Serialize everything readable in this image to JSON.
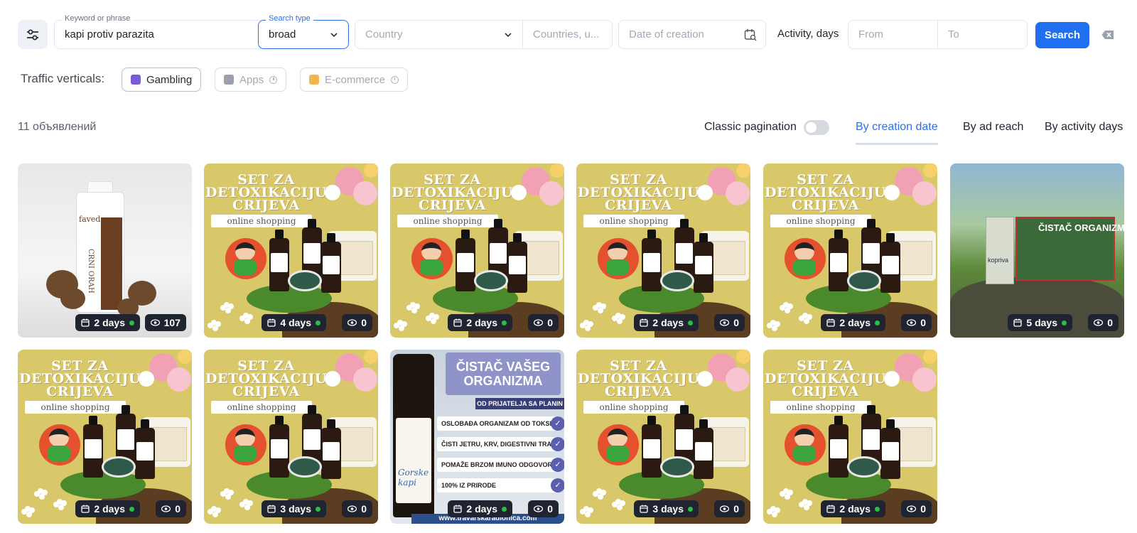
{
  "search": {
    "keyword_label": "Keyword or phrase",
    "keyword_value": "kapi protiv parazita",
    "search_type_label": "Search type",
    "search_type_value": "broad",
    "country_placeholder": "Country",
    "countries_placeholder": "Countries, u...",
    "date_placeholder": "Date of creation",
    "activity_label": "Activity, days",
    "from_placeholder": "From",
    "to_placeholder": "To",
    "search_button": "Search"
  },
  "verticals": {
    "label": "Traffic verticals:",
    "items": [
      {
        "label": "Gambling",
        "active": true,
        "color": "#7b5cd6"
      },
      {
        "label": "Apps",
        "active": false,
        "color": "#9aa0ad"
      },
      {
        "label": "E-commerce",
        "active": false,
        "color": "#f0b84a"
      }
    ]
  },
  "results": {
    "count_text": "11 объявлений",
    "classic_pagination_label": "Classic pagination",
    "classic_pagination_on": false,
    "sort_options": [
      "By creation date",
      "By ad reach",
      "By activity days"
    ],
    "active_sort": "By creation date"
  },
  "cards": [
    {
      "kind": "walnut",
      "days": "2 days",
      "views": "107",
      "brand": "faveda.",
      "product": "CRNI ORAH"
    },
    {
      "kind": "detox",
      "days": "4 days",
      "views": "0",
      "title": [
        "SET ZA",
        "DETOXIKACIJU",
        "CRIJEVA"
      ],
      "tag": "online shopping"
    },
    {
      "kind": "detox",
      "days": "2 days",
      "views": "0",
      "title": [
        "SET ZA",
        "DETOXIKACIJU",
        "CRIJEVA"
      ],
      "tag": "online shopping"
    },
    {
      "kind": "detox",
      "days": "2 days",
      "views": "0",
      "title": [
        "SET ZA",
        "DETOXIKACIJU",
        "CRIJEVA"
      ],
      "tag": "online shopping"
    },
    {
      "kind": "detox",
      "days": "2 days",
      "views": "0",
      "title": [
        "SET ZA",
        "DETOXIKACIJU",
        "CRIJEVA"
      ],
      "tag": "online shopping"
    },
    {
      "kind": "forest",
      "days": "5 days",
      "views": "0",
      "box_title": "ČISTAČ ORGANIZMA",
      "brand": "kopriva"
    },
    {
      "kind": "detox",
      "days": "2 days",
      "views": "0",
      "title": [
        "SET ZA",
        "DETOXIKACIJU",
        "CRIJEVA"
      ],
      "tag": "online shopping"
    },
    {
      "kind": "detox",
      "days": "3 days",
      "views": "0",
      "title": [
        "SET ZA",
        "DETOXIKACIJU",
        "CRIJEVA"
      ],
      "tag": "online shopping"
    },
    {
      "kind": "gorske",
      "days": "2 days",
      "views": "0",
      "head": [
        "ČISTAČ VAŠEG",
        "ORGANIZMA"
      ],
      "sub": "OD PRIJATELJA SA PLANIN",
      "lines": [
        "OSLOBAĐA ORGANIZAM OD TOKSINA",
        "ČISTI JETRU, KRV, DIGESTIVNI TRAKT",
        "POMAŽE BRZOM IMUNO ODGOVORU",
        "100% IZ PRIRODE"
      ],
      "url": "www.travarskaradionica.com",
      "label_text": "Gorske kapi"
    },
    {
      "kind": "detox",
      "days": "3 days",
      "views": "0",
      "title": [
        "SET ZA",
        "DETOXIKACIJU",
        "CRIJEVA"
      ],
      "tag": "online shopping"
    },
    {
      "kind": "detox",
      "days": "2 days",
      "views": "0",
      "title": [
        "SET ZA",
        "DETOXIKACIJU",
        "CRIJEVA"
      ],
      "tag": "online shopping"
    }
  ],
  "colors": {
    "accent": "#1f6ff0",
    "active_sort": "#2f6fe8",
    "badge_bg": "#1f2430",
    "live_dot": "#27c043"
  }
}
